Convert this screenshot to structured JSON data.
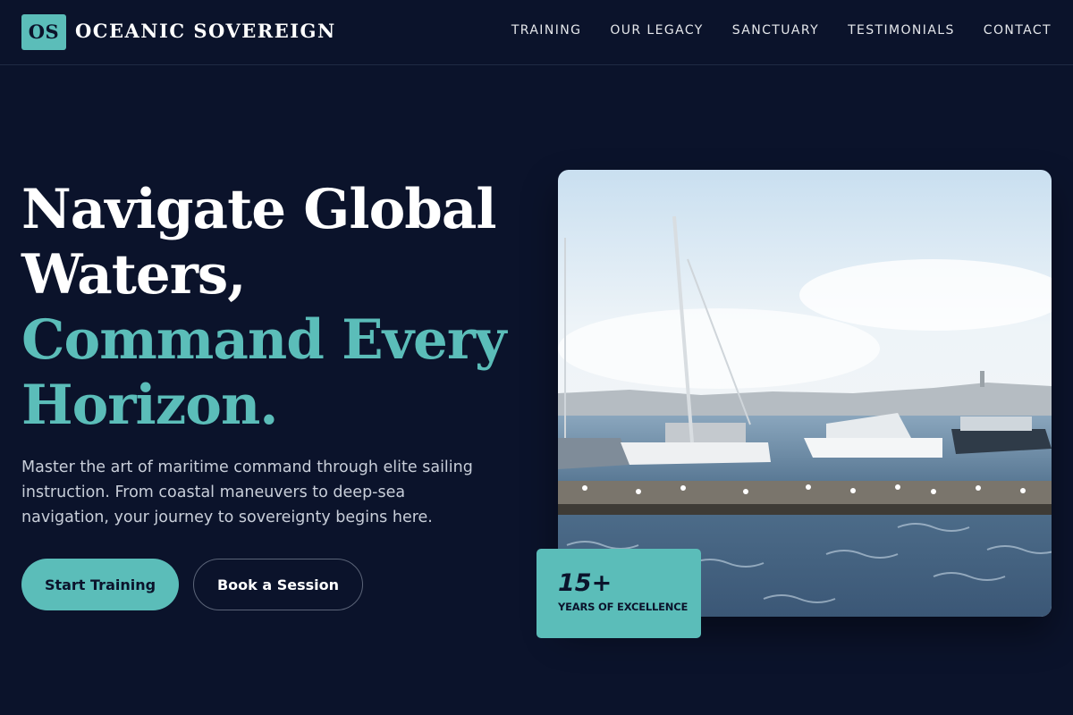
{
  "header": {
    "logo_mark": "OS",
    "brand": "OCEANIC SOVEREIGN",
    "nav": [
      "TRAINING",
      "OUR LEGACY",
      "SANCTUARY",
      "TESTIMONIALS",
      "CONTACT"
    ]
  },
  "hero": {
    "title_line1": "Navigate Global",
    "title_line2": "Waters,",
    "title_line3": "Command Every",
    "title_line4": "Horizon.",
    "description": "Master the art of maritime command through elite sailing instruction. From coastal maneuvers to deep-sea navigation, your journey to sovereignty begins here.",
    "primary_button": "Start Training",
    "secondary_button": "Book a Session"
  },
  "badge": {
    "number": "15+",
    "label": "YEARS OF EXCELLENCE"
  },
  "colors": {
    "background": "#0b132b",
    "accent": "#5bbdb9",
    "text": "#ffffff",
    "muted_text": "#c8ced9"
  }
}
